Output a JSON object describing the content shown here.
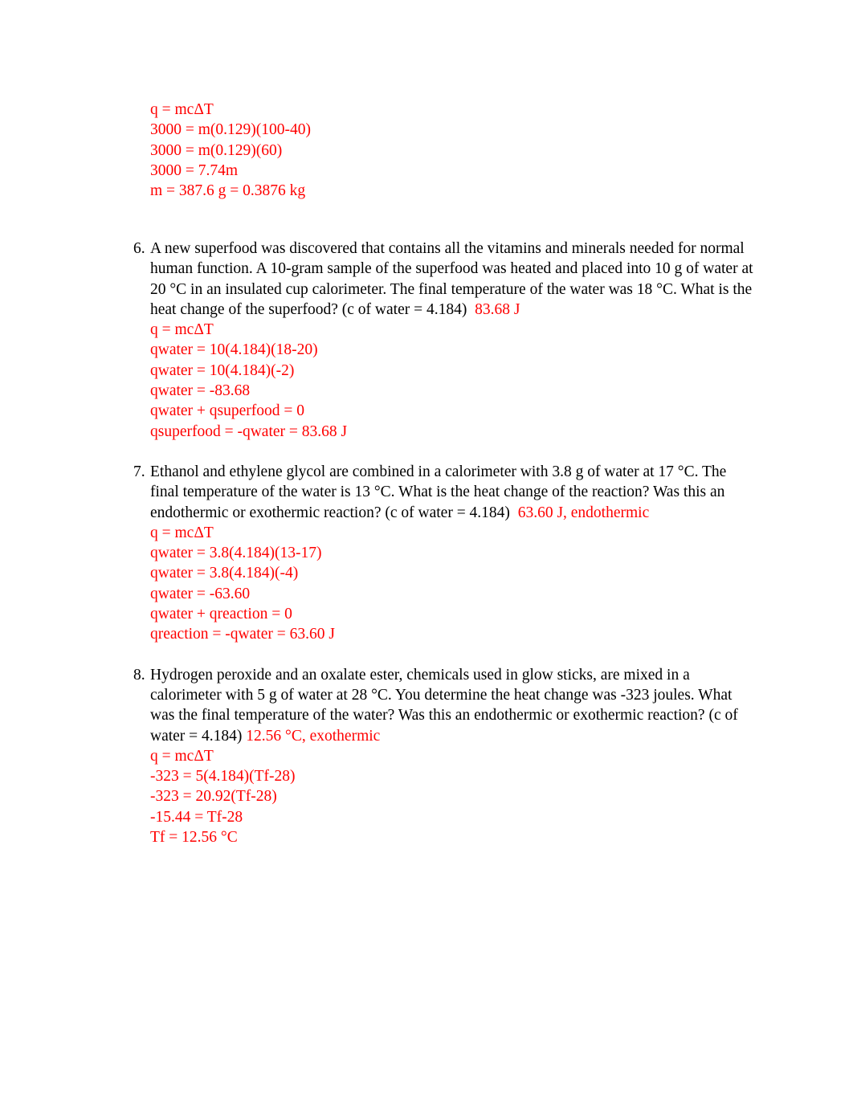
{
  "document": {
    "type": "chemistry-worksheet-answer-key",
    "answer_color": "#ff0000",
    "text_color": "#000000",
    "background_color": "#ffffff"
  },
  "orphan_solution": {
    "lines": [
      "q = mcΔT",
      "3000 = m(0.129)(100-40)",
      "3000 = m(0.129)(60)",
      "3000 = 7.74m",
      "m = 387.6 g = 0.3876 kg"
    ]
  },
  "questions": [
    {
      "number": "6.",
      "text": "A new superfood was discovered that contains all the vitamins and minerals needed for normal human function. A 10-gram sample of the superfood was heated and placed into 10 g of water at 20 °C in an insulated cup calorimeter. The final temperature of the water was 18 °C. What is the heat change of the superfood? (c of water = 4.184)",
      "answer": "83.68 J",
      "answer_gap": "wide",
      "solution": [
        "q = mcΔT",
        "qwater = 10(4.184)(18-20)",
        "qwater = 10(4.184)(-2)",
        "qwater = -83.68",
        "qwater + qsuperfood = 0",
        "qsuperfood = -qwater = 83.68 J"
      ]
    },
    {
      "number": "7.",
      "text": "Ethanol and ethylene glycol are combined in a calorimeter with 3.8 g of water at 17 °C. The final temperature of the water is 13 °C. What is the heat change of the reaction? Was this an endothermic or exothermic reaction? (c of water = 4.184)",
      "answer": "63.60 J, endothermic",
      "answer_gap": "wide",
      "solution": [
        "q = mcΔT",
        "qwater = 3.8(4.184)(13-17)",
        "qwater = 3.8(4.184)(-4)",
        "qwater = -63.60",
        "qwater + qreaction = 0",
        "qreaction = -qwater = 63.60 J"
      ]
    },
    {
      "number": "8.",
      "text": "Hydrogen peroxide and an oxalate ester, chemicals used in glow sticks, are mixed in a calorimeter with 5 g of water at 28 °C. You determine the heat change was -323 joules. What was the final temperature of the water? Was this an endothermic or exothermic reaction? (c of water = 4.184)",
      "answer": "12.56 °C, exothermic",
      "answer_gap": "narrow",
      "solution": [
        "q = mcΔT",
        "-323 = 5(4.184)(Tf-28)",
        "-323 = 20.92(Tf-28)",
        "-15.44 = Tf-28",
        "Tf = 12.56 °C"
      ]
    }
  ]
}
